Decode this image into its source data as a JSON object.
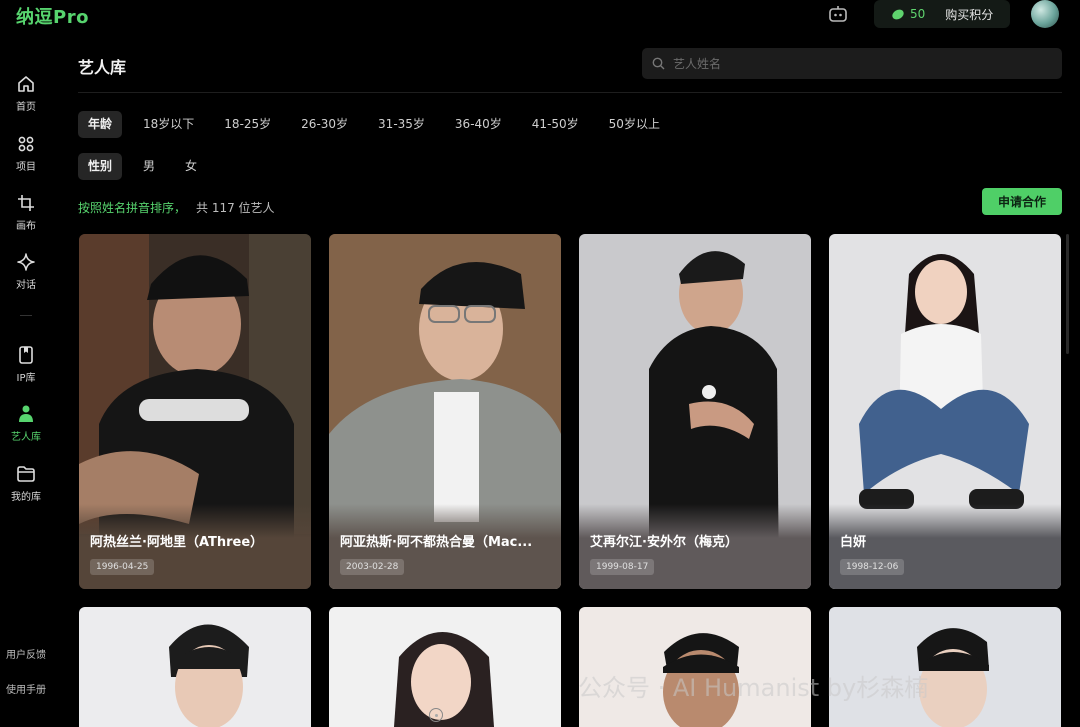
{
  "app": {
    "logo": "纳逗Pro"
  },
  "header": {
    "credits": "50",
    "buy_label": "购买积分"
  },
  "sidebar": {
    "items": [
      {
        "label": "首页",
        "icon": "home-icon"
      },
      {
        "label": "项目",
        "icon": "grid-icon"
      },
      {
        "label": "画布",
        "icon": "crop-icon"
      },
      {
        "label": "对话",
        "icon": "sparkle-icon"
      },
      {
        "label": "IP库",
        "icon": "bookmark-icon"
      },
      {
        "label": "艺人库",
        "icon": "person-icon",
        "active": true
      },
      {
        "label": "我的库",
        "icon": "folder-icon"
      }
    ],
    "feedback": "用户反馈",
    "manual": "使用手册"
  },
  "main": {
    "title": "艺人库",
    "search": {
      "placeholder": "艺人姓名"
    },
    "filters": {
      "age": {
        "label": "年龄",
        "options": [
          "18岁以下",
          "18-25岁",
          "26-30岁",
          "31-35岁",
          "36-40岁",
          "41-50岁",
          "50岁以上"
        ]
      },
      "gender": {
        "label": "性别",
        "options": [
          "男",
          "女"
        ]
      }
    },
    "sort_text": "按照姓名拼音排序，",
    "count_text": "共 117 位艺人",
    "apply_button": "申请合作",
    "artists": [
      {
        "name": "阿热丝兰·阿地里（AThree）",
        "dob": "1996-04-25"
      },
      {
        "name": "阿亚热斯·阿不都热合曼（Mac...",
        "dob": "2003-02-28"
      },
      {
        "name": "艾再尔江·安外尔（梅克）",
        "dob": "1999-08-17"
      },
      {
        "name": "白妍",
        "dob": "1998-12-06"
      }
    ]
  },
  "watermark": "公众号 · AI Humanist by杉森楠",
  "colors": {
    "accent": "#57d46e",
    "background": "#000000"
  }
}
